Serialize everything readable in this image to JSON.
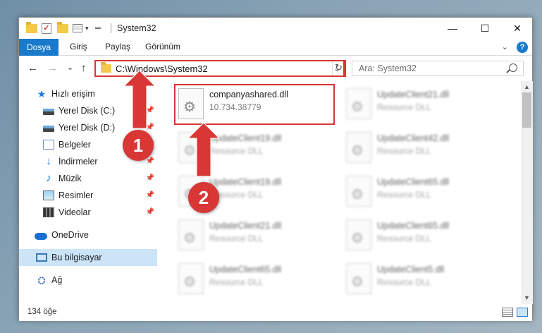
{
  "window": {
    "title": "System32",
    "controls": {
      "minimize": "—",
      "maximize": "☐",
      "close": "✕"
    }
  },
  "ribbon": {
    "file_tab": "Dosya",
    "tabs": [
      "Giriş",
      "Paylaş",
      "Görünüm"
    ],
    "help": "?"
  },
  "navigation": {
    "back": "←",
    "forward": "→",
    "recent": "⌄",
    "up": "↑",
    "address": "C:\\Windows\\System32",
    "address_dropdown": "⌄",
    "refresh": "↻",
    "search_placeholder": "Ara: System32"
  },
  "sidebar": {
    "items": [
      {
        "label": "Hızlı erişim",
        "icon": "star-icon",
        "pinned": false
      },
      {
        "label": "Yerel Disk (C:)",
        "icon": "disk-icon",
        "pinned": true
      },
      {
        "label": "Yerel Disk (D:)",
        "icon": "disk-icon",
        "pinned": true
      },
      {
        "label": "Belgeler",
        "icon": "document-icon",
        "pinned": true
      },
      {
        "label": "İndirmeler",
        "icon": "download-icon",
        "pinned": true
      },
      {
        "label": "Müzik",
        "icon": "music-icon",
        "pinned": true
      },
      {
        "label": "Resimler",
        "icon": "pictures-icon",
        "pinned": true
      },
      {
        "label": "Videolar",
        "icon": "videos-icon",
        "pinned": true
      },
      {
        "label": "OneDrive",
        "icon": "cloud-icon",
        "pinned": false
      },
      {
        "label": "Bu bilgisayar",
        "icon": "computer-icon",
        "pinned": false,
        "selected": true
      },
      {
        "label": "Ağ",
        "icon": "network-icon",
        "pinned": false
      }
    ]
  },
  "files": {
    "highlighted": {
      "name": "companyashared.dll",
      "detail": "10.734.38779"
    },
    "blurred": [
      {
        "name": "UpdateClient21.dll",
        "detail": "Resource DLL"
      },
      {
        "name": "UpdateClient19.dll",
        "detail": "Resource DLL"
      },
      {
        "name": "UpdateClient42.dll",
        "detail": "Resource DLL"
      },
      {
        "name": "UpdateClient19.dll",
        "detail": "Resource DLL"
      },
      {
        "name": "UpdateClient65.dll",
        "detail": "Resource DLL"
      },
      {
        "name": "UpdateClient21.dll",
        "detail": "Resource DLL"
      },
      {
        "name": "UpdateClient65.dll",
        "detail": "Resource DLL"
      },
      {
        "name": "UpdateClient65.dll",
        "detail": "Resource DLL"
      },
      {
        "name": "UpdateClient5.dll",
        "detail": "Resource DLL"
      }
    ]
  },
  "status": {
    "count": "134 öğe"
  },
  "callouts": [
    "1",
    "2"
  ],
  "colors": {
    "accent": "#1979ca",
    "highlight": "#d93636",
    "selected": "#cce4f7"
  }
}
